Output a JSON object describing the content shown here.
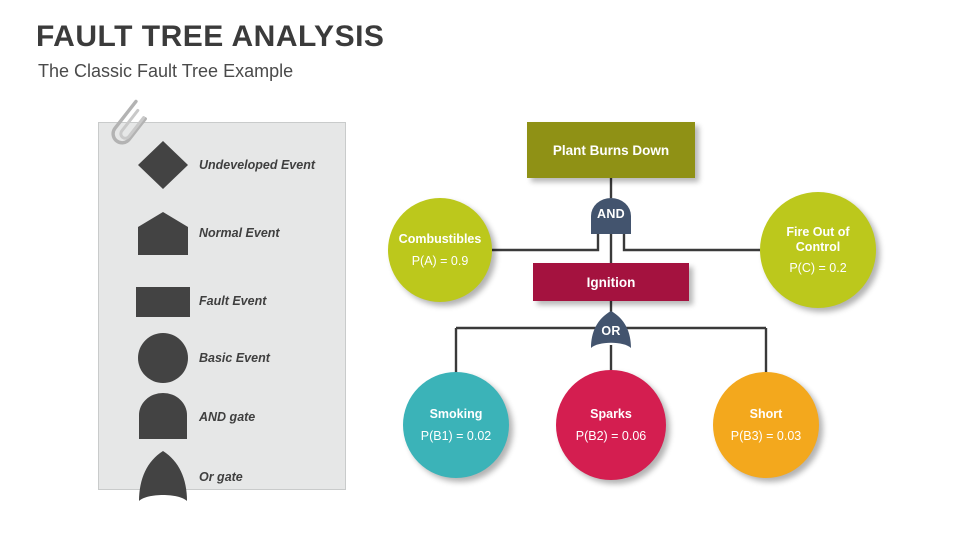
{
  "header": {
    "title": "FAULT TREE ANALYSIS",
    "subtitle": "The Classic Fault Tree Example"
  },
  "legend": {
    "items": [
      {
        "shape": "diamond",
        "label": "Undeveloped Event",
        "icon": "diamond-icon"
      },
      {
        "shape": "pentagon",
        "label": "Normal Event",
        "icon": "pentagon-icon"
      },
      {
        "shape": "rect",
        "label": "Fault Event",
        "icon": "rectangle-icon"
      },
      {
        "shape": "circle",
        "label": "Basic Event",
        "icon": "circle-icon"
      },
      {
        "shape": "and-gate",
        "label": "AND gate",
        "icon": "and-gate-icon"
      },
      {
        "shape": "or-gate",
        "label": "Or gate",
        "icon": "or-gate-icon"
      }
    ],
    "shape_color": "#434343",
    "panel_color": "#e6e7e7",
    "clip_icon": "paperclip-icon"
  },
  "chart_data": {
    "type": "diagram",
    "title": "FAULT TREE ANALYSIS",
    "subtitle": "The Classic Fault Tree Example",
    "nodes": [
      {
        "id": "plant",
        "label": "Plant Burns Down",
        "probability": "",
        "shape": "rect",
        "color": "#8f9115"
      },
      {
        "id": "combustibles",
        "label": "Combustibles",
        "probability": "P(A) = 0.9",
        "shape": "circle",
        "color": "#bcc81c"
      },
      {
        "id": "fire",
        "label": "Fire Out of Control",
        "probability": "P(C) = 0.2",
        "shape": "circle",
        "color": "#bcc81c"
      },
      {
        "id": "ignition",
        "label": "Ignition",
        "probability": "",
        "shape": "rect",
        "color": "#a4123f"
      },
      {
        "id": "smoking",
        "label": "Smoking",
        "probability": "P(B1) = 0.02",
        "shape": "circle",
        "color": "#3bb3b8"
      },
      {
        "id": "sparks",
        "label": "Sparks",
        "probability": "P(B2) = 0.06",
        "shape": "circle",
        "color": "#d41e50"
      },
      {
        "id": "short",
        "label": "Short",
        "probability": "P(B3) = 0.03",
        "shape": "circle",
        "color": "#f3a81d"
      }
    ],
    "gates": [
      {
        "id": "and-gate",
        "label": "AND",
        "type": "and",
        "color": "#43546e",
        "output": "plant",
        "inputs": [
          "combustibles",
          "fire",
          "ignition"
        ]
      },
      {
        "id": "or-gate",
        "label": "OR",
        "type": "or",
        "color": "#43546e",
        "output": "ignition",
        "inputs": [
          "smoking",
          "sparks",
          "short"
        ]
      }
    ],
    "connector_color": "#3a3a3a"
  },
  "nodes": {
    "plant": {
      "label": "Plant Burns Down"
    },
    "combustibles": {
      "label": "Combustibles",
      "prob": "P(A) = 0.9"
    },
    "fire": {
      "label": "Fire Out of Control",
      "prob": "P(C) = 0.2"
    },
    "ignition": {
      "label": "Ignition"
    },
    "smoking": {
      "label": "Smoking",
      "prob": "P(B1) = 0.02"
    },
    "sparks": {
      "label": "Sparks",
      "prob": "P(B2) = 0.06"
    },
    "short": {
      "label": "Short",
      "prob": "P(B3) = 0.03"
    }
  },
  "gates": {
    "and": {
      "label": "AND"
    },
    "or": {
      "label": "OR"
    }
  }
}
